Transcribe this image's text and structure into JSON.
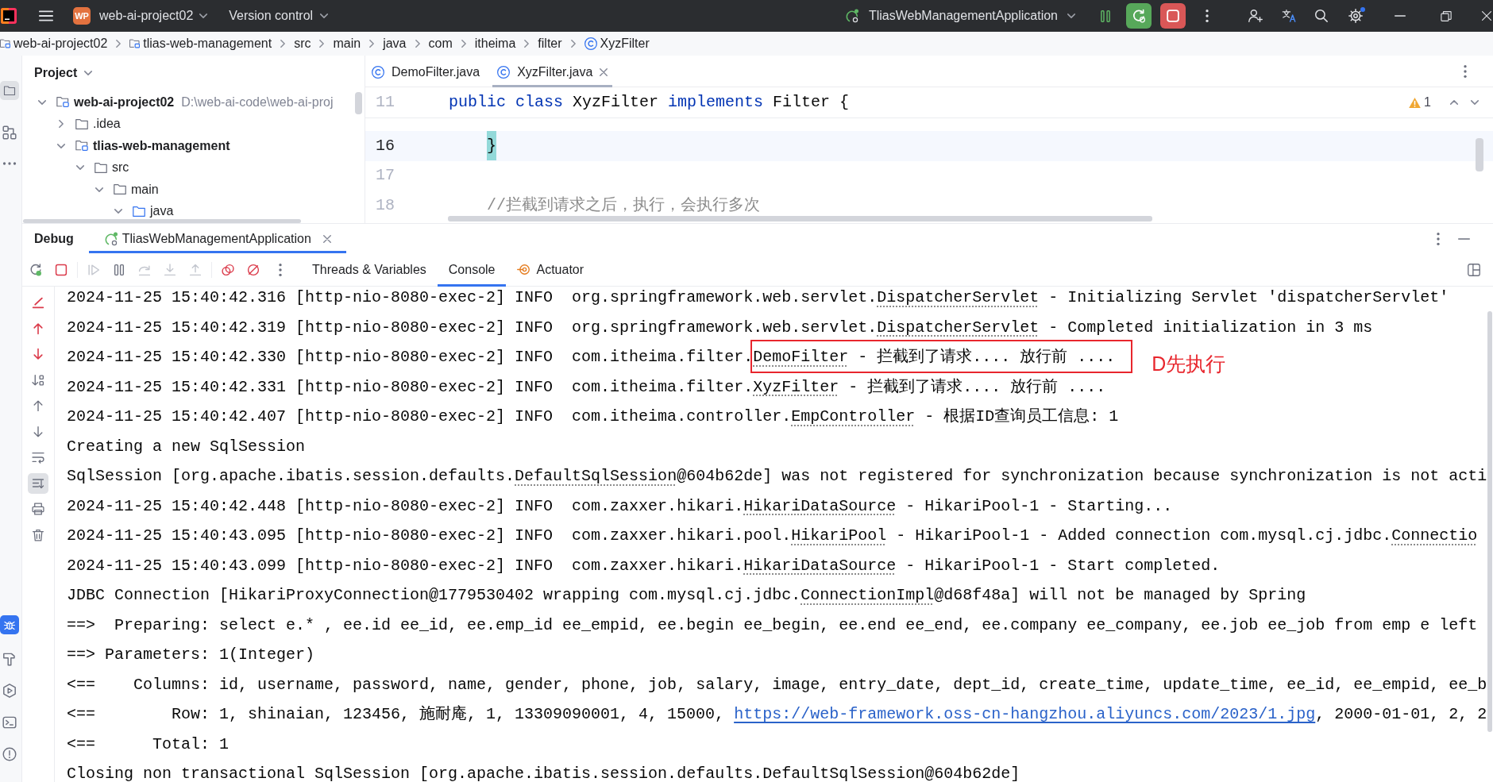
{
  "title_bar": {
    "project_badge": "WP",
    "project": "web-ai-project02",
    "vcs": "Version control",
    "run_config": "TliasWebManagementApplication"
  },
  "breadcrumbs": [
    {
      "label": "web-ai-project02",
      "kind": "module"
    },
    {
      "label": "tlias-web-management",
      "kind": "module"
    },
    {
      "label": "src",
      "kind": "package"
    },
    {
      "label": "main",
      "kind": "package"
    },
    {
      "label": "java",
      "kind": "package"
    },
    {
      "label": "com",
      "kind": "package"
    },
    {
      "label": "itheima",
      "kind": "package"
    },
    {
      "label": "filter",
      "kind": "package"
    },
    {
      "label": "XyzFilter",
      "kind": "class"
    }
  ],
  "tool_strip": {
    "top": [
      {
        "kind": "project",
        "selected": true
      },
      {
        "kind": "structure",
        "selected": false
      },
      {
        "kind": "more",
        "selected": false
      }
    ],
    "bottom": [
      {
        "kind": "debug",
        "selected": true
      },
      {
        "kind": "build",
        "selected": false
      },
      {
        "kind": "run",
        "selected": false
      },
      {
        "kind": "terminal",
        "selected": false
      },
      {
        "kind": "problems",
        "selected": false
      }
    ]
  },
  "project_panel": {
    "title": "Project",
    "tree": [
      {
        "label": "web-ai-project02",
        "kind": "module",
        "path": "D:\\web-ai-code\\web-ai-proj",
        "expanded": true,
        "children": [
          {
            "label": ".idea",
            "kind": "folder",
            "expanded": false
          },
          {
            "label": "tlias-web-management",
            "kind": "module",
            "expanded": true,
            "children": [
              {
                "label": "src",
                "kind": "folder",
                "expanded": true,
                "children": [
                  {
                    "label": "main",
                    "kind": "folder",
                    "expanded": true,
                    "children": [
                      {
                        "label": "java",
                        "kind": "source_folder",
                        "expanded": true
                      }
                    ]
                  }
                ]
              }
            ]
          }
        ]
      }
    ]
  },
  "editor": {
    "tabs": [
      {
        "label": "DemoFilter.java",
        "selected": false
      },
      {
        "label": "XyzFilter.java",
        "selected": true
      }
    ],
    "warning_count": "1",
    "sticky_line": {
      "number": "11",
      "tokens": [
        {
          "text": "public class",
          "kind": "keyword"
        },
        {
          "text": " XyzFilter ",
          "kind": "plain"
        },
        {
          "text": "implements",
          "kind": "keyword"
        },
        {
          "text": " Filter {",
          "kind": "plain"
        }
      ]
    },
    "lines": [
      {
        "number": "16",
        "current": true,
        "tokens": [
          {
            "text": "    }",
            "kind": "brace_match"
          }
        ]
      },
      {
        "number": "17",
        "current": false
      },
      {
        "number": "18",
        "current": false,
        "tokens": [
          {
            "text": "    //拦截到请求之后，执行，会执行多次",
            "kind": "comment"
          }
        ]
      }
    ]
  },
  "debug_panel": {
    "title": "Debug",
    "session": {
      "label": "TliasWebManagementApplication",
      "selected": true
    },
    "toolbar": [
      {
        "kind": "rerun",
        "disabled": false
      },
      {
        "kind": "stop",
        "disabled": false
      },
      {
        "kind": "resume",
        "disabled": true
      },
      {
        "kind": "pause",
        "disabled": false
      },
      {
        "kind": "step_over",
        "disabled": true
      },
      {
        "kind": "step_into",
        "disabled": true
      },
      {
        "kind": "step_out",
        "disabled": true
      },
      {
        "kind": "view_breakpoints",
        "disabled": false
      },
      {
        "kind": "mute_breakpoints",
        "disabled": false
      }
    ],
    "tabs": [
      {
        "label": "Threads & Variables",
        "kind": "text",
        "selected": false
      },
      {
        "label": "Console",
        "kind": "text",
        "selected": true
      },
      {
        "label": "Actuator",
        "kind": "actuator",
        "selected": false
      }
    ],
    "console_tools": [
      {
        "kind": "clear",
        "on": false
      },
      {
        "kind": "previous_error",
        "on": false
      },
      {
        "kind": "next_error",
        "on": false
      },
      {
        "kind": "sort",
        "on": false
      },
      {
        "kind": "up",
        "on": false
      },
      {
        "kind": "down",
        "on": false
      },
      {
        "kind": "soft_wrap",
        "on": false
      },
      {
        "kind": "scroll_to_end",
        "on": true
      },
      {
        "kind": "print",
        "on": false
      },
      {
        "kind": "delete",
        "on": false
      }
    ],
    "console": [
      {
        "segments": [
          {
            "text": "2024-11-25 15:40:42.316 [http-nio-8080-exec-2] INFO  org.springframework.web.servlet.",
            "kind": "plain"
          },
          {
            "text": "DispatcherServlet",
            "kind": "class_link"
          },
          {
            "text": " - Initializing Servlet 'dispatcherServlet'",
            "kind": "plain"
          }
        ]
      },
      {
        "segments": [
          {
            "text": "2024-11-25 15:40:42.319 [http-nio-8080-exec-2] INFO  org.springframework.web.servlet.",
            "kind": "plain"
          },
          {
            "text": "DispatcherServlet",
            "kind": "class_link"
          },
          {
            "text": " - Completed initialization in 3 ms",
            "kind": "plain"
          }
        ]
      },
      {
        "segments": [
          {
            "text": "2024-11-25 15:40:42.330 [http-nio-8080-exec-2] INFO  com.itheima.filter.",
            "kind": "plain"
          },
          {
            "text": "DemoFilter",
            "kind": "class_link",
            "boxed": true
          },
          {
            "text": " - 拦截到了请求.... 放行前 ....",
            "kind": "plain",
            "boxed": true
          }
        ],
        "annotation": "D先执行"
      },
      {
        "segments": [
          {
            "text": "2024-11-25 15:40:42.331 [http-nio-8080-exec-2] INFO  com.itheima.filter.",
            "kind": "plain"
          },
          {
            "text": "XyzFilter",
            "kind": "class_link"
          },
          {
            "text": " - 拦截到了请求.... 放行前 ....",
            "kind": "plain"
          }
        ]
      },
      {
        "segments": [
          {
            "text": "2024-11-25 15:40:42.407 [http-nio-8080-exec-2] INFO  com.itheima.controller.",
            "kind": "plain"
          },
          {
            "text": "EmpController",
            "kind": "class_link"
          },
          {
            "text": " - 根据ID查询员工信息: 1",
            "kind": "plain"
          }
        ]
      },
      {
        "segments": [
          {
            "text": "Creating a new SqlSession",
            "kind": "plain"
          }
        ]
      },
      {
        "segments": [
          {
            "text": "SqlSession [org.apache.ibatis.session.defaults.",
            "kind": "plain"
          },
          {
            "text": "DefaultSqlSession",
            "kind": "class_link"
          },
          {
            "text": "@604b62de] was not registered for synchronization because synchronization is not acti",
            "kind": "plain"
          }
        ]
      },
      {
        "segments": [
          {
            "text": "2024-11-25 15:40:42.448 [http-nio-8080-exec-2] INFO  com.zaxxer.hikari.",
            "kind": "plain"
          },
          {
            "text": "HikariDataSource",
            "kind": "class_link"
          },
          {
            "text": " - HikariPool-1 - Starting...",
            "kind": "plain"
          }
        ]
      },
      {
        "segments": [
          {
            "text": "2024-11-25 15:40:43.095 [http-nio-8080-exec-2] INFO  com.zaxxer.hikari.pool.",
            "kind": "plain"
          },
          {
            "text": "HikariPool",
            "kind": "class_link"
          },
          {
            "text": " - HikariPool-1 - Added connection com.mysql.cj.jdbc.",
            "kind": "plain"
          },
          {
            "text": "Connectio",
            "kind": "class_link"
          }
        ]
      },
      {
        "segments": [
          {
            "text": "2024-11-25 15:40:43.099 [http-nio-8080-exec-2] INFO  com.zaxxer.hikari.",
            "kind": "plain"
          },
          {
            "text": "HikariDataSource",
            "kind": "class_link"
          },
          {
            "text": " - HikariPool-1 - Start completed.",
            "kind": "plain"
          }
        ]
      },
      {
        "segments": [
          {
            "text": "JDBC Connection [HikariProxyConnection@1779530402 wrapping com.mysql.cj.jdbc.",
            "kind": "plain"
          },
          {
            "text": "ConnectionImpl",
            "kind": "class_link"
          },
          {
            "text": "@d68f48a] will not be managed by Spring",
            "kind": "plain"
          }
        ]
      },
      {
        "segments": [
          {
            "text": "==>  Preparing: select e.* , ee.id ee_id, ee.emp_id ee_empid, ee.begin ee_begin, ee.end ee_end, ee.company ee_company, ee.job ee_job from emp e left",
            "kind": "plain"
          }
        ]
      },
      {
        "segments": [
          {
            "text": "==> Parameters: 1(Integer)",
            "kind": "plain"
          }
        ]
      },
      {
        "segments": [
          {
            "text": "<==    Columns: id, username, password, name, gender, phone, job, salary, image, entry_date, dept_id, create_time, update_time, ee_id, ee_empid, ee_b",
            "kind": "plain"
          }
        ]
      },
      {
        "segments": [
          {
            "text": "<==        Row: 1, shinaian, 123456, 施耐庵, 1, 13309090001, 4, 15000, ",
            "kind": "plain"
          },
          {
            "text": "https://web-framework.oss-cn-hangzhou.aliyuncs.com/2023/1.jpg",
            "kind": "url"
          },
          {
            "text": ", 2000-01-01, 2, 2",
            "kind": "plain"
          }
        ]
      },
      {
        "segments": [
          {
            "text": "<==      Total: 1",
            "kind": "plain"
          }
        ]
      },
      {
        "segments": [
          {
            "text": "Closing non transactional SqlSession [org.apache.ibatis.session.defaults.",
            "kind": "plain"
          },
          {
            "text": "DefaultSqlSession",
            "kind": "class_link"
          },
          {
            "text": "@604b62de]",
            "kind": "plain"
          }
        ]
      }
    ]
  }
}
